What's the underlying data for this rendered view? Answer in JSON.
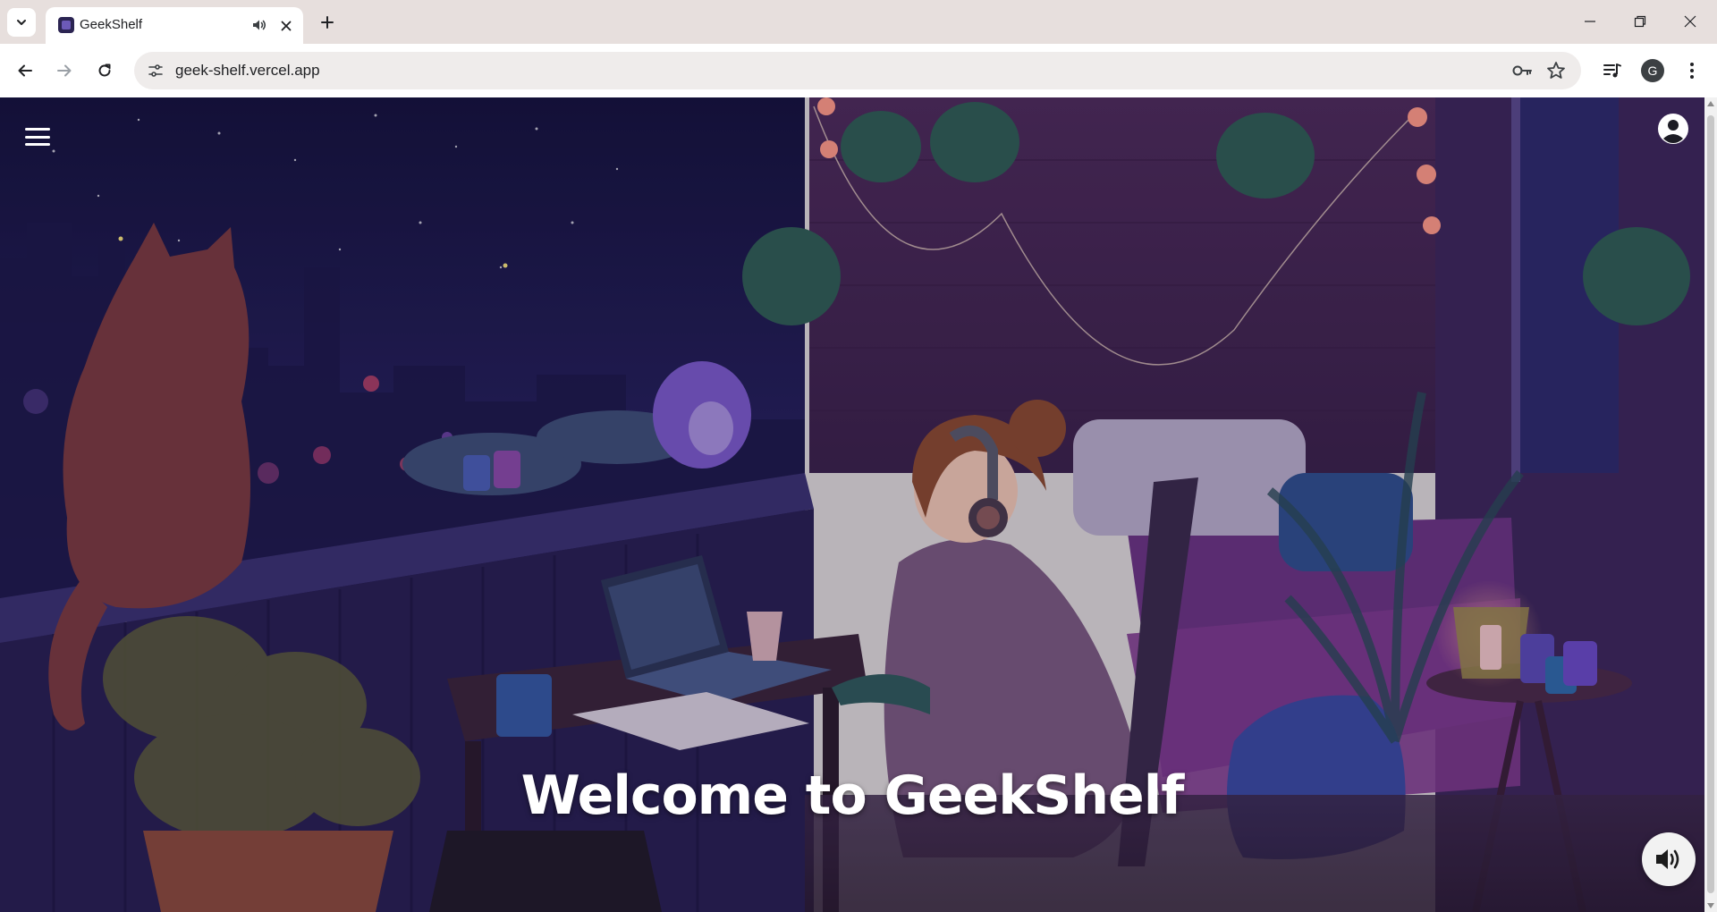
{
  "browser": {
    "tab": {
      "title": "GeekShelf",
      "favicon": "geekshelf-favicon",
      "audio_icon": "speaker-icon",
      "close_icon": "close-icon"
    },
    "new_tab_icon": "plus-icon",
    "tab_list_icon": "chevron-down-icon",
    "window_controls": [
      "minimize-icon",
      "restore-icon",
      "close-icon"
    ],
    "toolbar": {
      "url": "geek-shelf.vercel.app",
      "back_icon": "arrow-left-icon",
      "forward_icon": "arrow-right-icon",
      "reload_icon": "reload-icon",
      "site_info_icon": "tune-icon",
      "password_icon": "key-icon",
      "bookmark_icon": "star-icon",
      "media_icon": "media-queue-icon",
      "profile_initial": "G",
      "menu_icon": "kebab-menu-icon"
    }
  },
  "page": {
    "menu_icon": "hamburger-icon",
    "account_icon": "user-circle-icon",
    "hero_title": "Welcome to GeekShelf",
    "sound_icon": "volume-up-icon",
    "background": "lofi-night-balcony-illustration"
  },
  "colors": {
    "tabstrip_bg": "#e7dfdd",
    "omnibox_bg": "#efeceb",
    "scene_sky": "#231a4f",
    "scene_wall": "#4a2a56",
    "hero_text": "#ffffff"
  }
}
